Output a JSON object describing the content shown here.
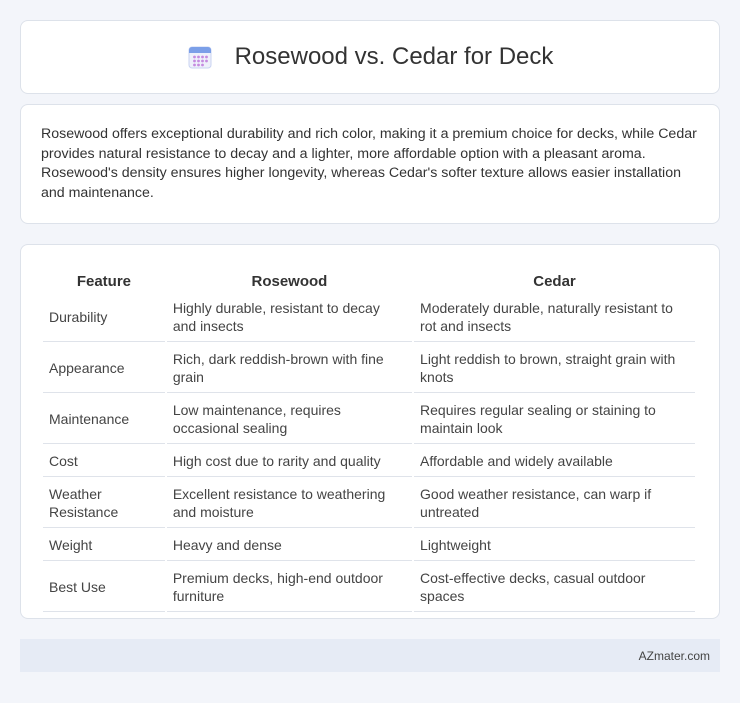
{
  "header": {
    "title": "Rosewood vs. Cedar for Deck",
    "icon": "calendar-icon"
  },
  "summary": {
    "text": "Rosewood offers exceptional durability and rich color, making it a premium choice for decks, while Cedar provides natural resistance to decay and a lighter, more affordable option with a pleasant aroma. Rosewood's density ensures higher longevity, whereas Cedar's softer texture allows easier installation and maintenance."
  },
  "table": {
    "headers": [
      "Feature",
      "Rosewood",
      "Cedar"
    ],
    "rows": [
      [
        "Durability",
        "Highly durable, resistant to decay and insects",
        "Moderately durable, naturally resistant to rot and insects"
      ],
      [
        "Appearance",
        "Rich, dark reddish-brown with fine grain",
        "Light reddish to brown, straight grain with knots"
      ],
      [
        "Maintenance",
        "Low maintenance, requires occasional sealing",
        "Requires regular sealing or staining to maintain look"
      ],
      [
        "Cost",
        "High cost due to rarity and quality",
        "Affordable and widely available"
      ],
      [
        "Weather Resistance",
        "Excellent resistance to weathering and moisture",
        "Good weather resistance, can warp if untreated"
      ],
      [
        "Weight",
        "Heavy and dense",
        "Lightweight"
      ],
      [
        "Best Use",
        "Premium decks, high-end outdoor furniture",
        "Cost-effective decks, casual outdoor spaces"
      ]
    ]
  },
  "footer": {
    "text": "AZmater.com"
  },
  "colors": {
    "background": "#f3f5fa",
    "card": "#ffffff",
    "footer_bg": "#e6ebf5",
    "icon_accent": "#7b9fe8",
    "icon_dots": "#c58be0"
  }
}
